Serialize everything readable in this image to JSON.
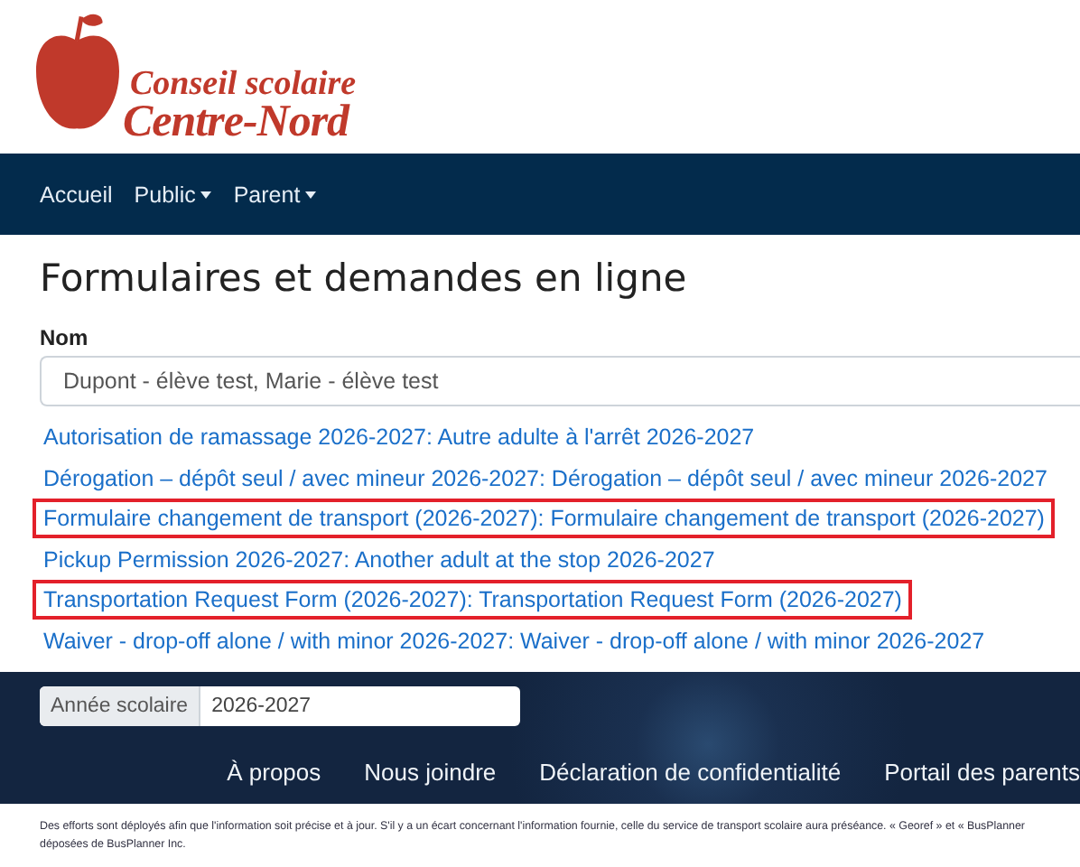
{
  "logo": {
    "line_1": "Conseil scolaire",
    "line_2": "Centre-Nord"
  },
  "nav": [
    {
      "label": "Accueil",
      "dropdown": false
    },
    {
      "label": "Public",
      "dropdown": true
    },
    {
      "label": "Parent",
      "dropdown": true
    }
  ],
  "page_title": "Formulaires et demandes en ligne",
  "name_field": {
    "label": "Nom",
    "value": "Dupont - élève test, Marie - élève test"
  },
  "forms": [
    {
      "label": "Autorisation de ramassage 2026-2027: Autre adulte à l'arrêt 2026-2027",
      "highlighted": false
    },
    {
      "label": "Dérogation – dépôt seul / avec mineur 2026-2027: Dérogation – dépôt seul / avec mineur 2026-2027",
      "highlighted": false
    },
    {
      "label": "Formulaire changement de transport (2026-2027): Formulaire changement de transport (2026-2027)",
      "highlighted": true
    },
    {
      "label": "Pickup Permission 2026-2027: Another adult at the stop 2026-2027",
      "highlighted": false
    },
    {
      "label": "Transportation Request Form (2026-2027): Transportation Request Form (2026-2027)",
      "highlighted": true
    },
    {
      "label": "Waiver - drop-off alone / with minor 2026-2027: Waiver - drop-off alone / with minor 2026-2027",
      "highlighted": false
    }
  ],
  "school_year": {
    "label": "Année scolaire",
    "value": "2026-2027"
  },
  "footer_links": [
    "À propos",
    "Nous joindre",
    "Déclaration de confidentialité",
    "Portail des parents"
  ],
  "disclaimer": [
    "Des efforts sont déployés afin que l'information soit précise et à jour. S'il y a un écart concernant l'information fournie, celle du service de transport scolaire aura préséance. « Georef » et « BusPlanner",
    "déposées de BusPlanner Inc."
  ]
}
